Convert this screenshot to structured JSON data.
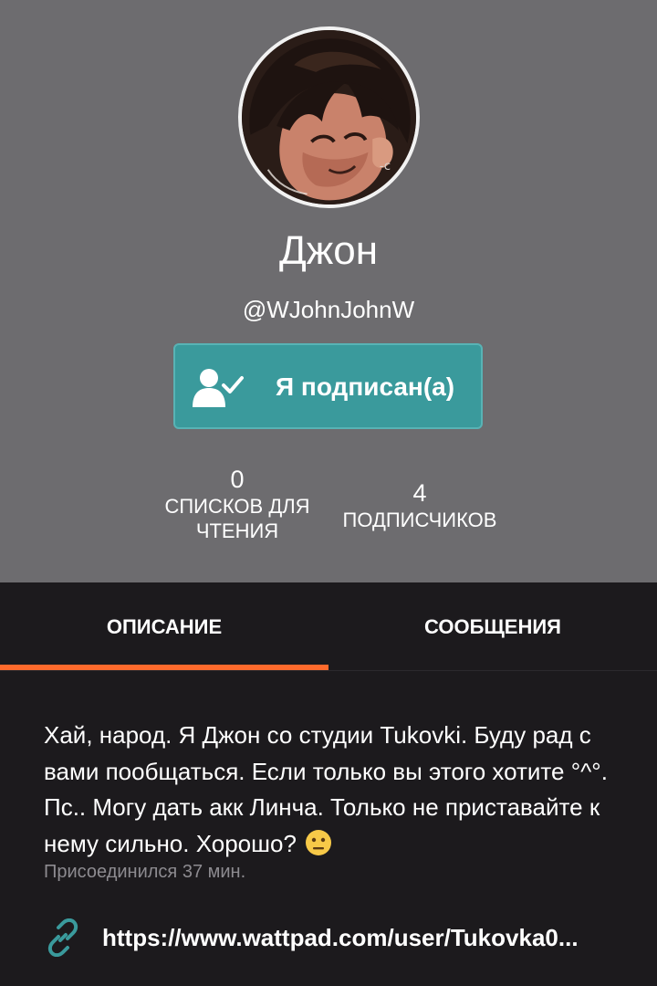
{
  "profile": {
    "display_name": "Джон",
    "username": "@WJohnJohnW",
    "follow_button_label": "Я подписан(а)"
  },
  "stats": {
    "reading_lists": {
      "value": "0",
      "label": "Списков для чтения"
    },
    "followers": {
      "value": "4",
      "label": "подписчиков"
    }
  },
  "tabs": [
    {
      "label": "ОПИСАНИЕ",
      "active": true
    },
    {
      "label": "СООБЩЕНИЯ",
      "active": false
    }
  ],
  "about": {
    "description": "Хай, народ. Я Джон со студии Tukovki. Буду рад с вами пообщаться. Если только вы этого хотите °^°. Пс.. Могу дать акк Линча. Только не приставайте к нему сильно. Хорошо?",
    "emoji": "neutral-face",
    "joined": "Присоединился 37 мин.",
    "link": "https://www.wattpad.com/user/Tukovka0..."
  },
  "colors": {
    "header_bg": "#6d6c6f",
    "page_bg": "#1c1a1d",
    "follow_button": "#3a9a9c",
    "tab_indicator": "#ff6a2c",
    "link_icon": "#3a9a9c",
    "muted_text": "#8d8b90"
  },
  "icons": {
    "follow": "user-check-icon",
    "link": "link-icon"
  }
}
